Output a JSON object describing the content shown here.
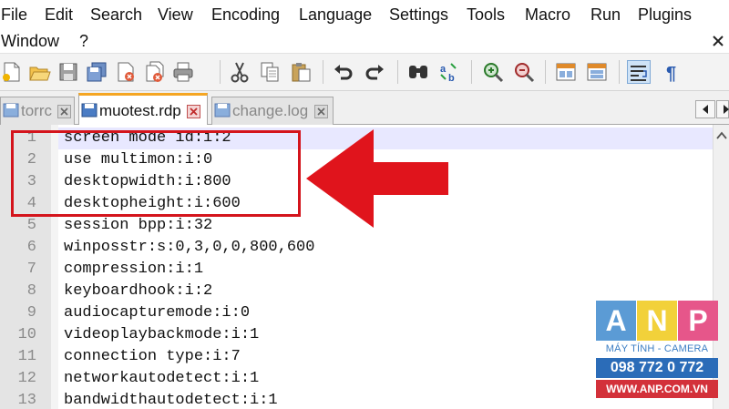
{
  "menu": {
    "file": "File",
    "edit": "Edit",
    "search": "Search",
    "view": "View",
    "encoding": "Encoding",
    "language": "Language",
    "settings": "Settings",
    "tools": "Tools",
    "macro": "Macro",
    "run": "Run",
    "plugins": "Plugins",
    "window": "Window",
    "help": "?"
  },
  "tabs": [
    {
      "label": "torrc",
      "active": false
    },
    {
      "label": "muotest.rdp",
      "active": true
    },
    {
      "label": "change.log",
      "active": false
    }
  ],
  "editor": {
    "current_line": 1,
    "lines": [
      {
        "num": "1",
        "text": "screen mode id:i:2"
      },
      {
        "num": "2",
        "text": "use multimon:i:0"
      },
      {
        "num": "3",
        "text": "desktopwidth:i:800"
      },
      {
        "num": "4",
        "text": "desktopheight:i:600"
      },
      {
        "num": "5",
        "text": "session bpp:i:32"
      },
      {
        "num": "6",
        "text": "winposstr:s:0,3,0,0,800,600"
      },
      {
        "num": "7",
        "text": "compression:i:1"
      },
      {
        "num": "8",
        "text": "keyboardhook:i:2"
      },
      {
        "num": "9",
        "text": "audiocapturemode:i:0"
      },
      {
        "num": "10",
        "text": "videoplaybackmode:i:1"
      },
      {
        "num": "11",
        "text": "connection type:i:7"
      },
      {
        "num": "12",
        "text": "networkautodetect:i:1"
      },
      {
        "num": "13",
        "text": "bandwidthautodetect:i:1"
      }
    ]
  },
  "toolbar_icons": [
    "new-file-icon",
    "open-file-icon",
    "save-icon",
    "save-all-icon",
    "close-icon",
    "close-all-icon",
    "print-icon",
    "cut-icon",
    "copy-icon",
    "paste-icon",
    "undo-icon",
    "redo-icon",
    "find-icon",
    "replace-icon",
    "zoom-in-icon",
    "zoom-out-icon",
    "sync-vertical-icon",
    "sync-horizontal-icon",
    "word-wrap-icon",
    "show-all-characters-icon"
  ],
  "annotation": {
    "box_color": "#d4141c",
    "arrow_color": "#e0141c",
    "highlighted_lines": [
      1,
      4
    ]
  },
  "watermark": {
    "letters": [
      "A",
      "N",
      "P"
    ],
    "letter_colors": [
      "#5b9bd5",
      "#f2d13a",
      "#e6568a"
    ],
    "tagline": "MÁY TÍNH - CAMERA",
    "phone": "098 772 0 772",
    "website": "WWW.ANP.COM.VN"
  },
  "colors": {
    "gutter": "#e4e4e4",
    "current_line": "#e8e8ff",
    "active_tab_accent": "#f5a623"
  }
}
